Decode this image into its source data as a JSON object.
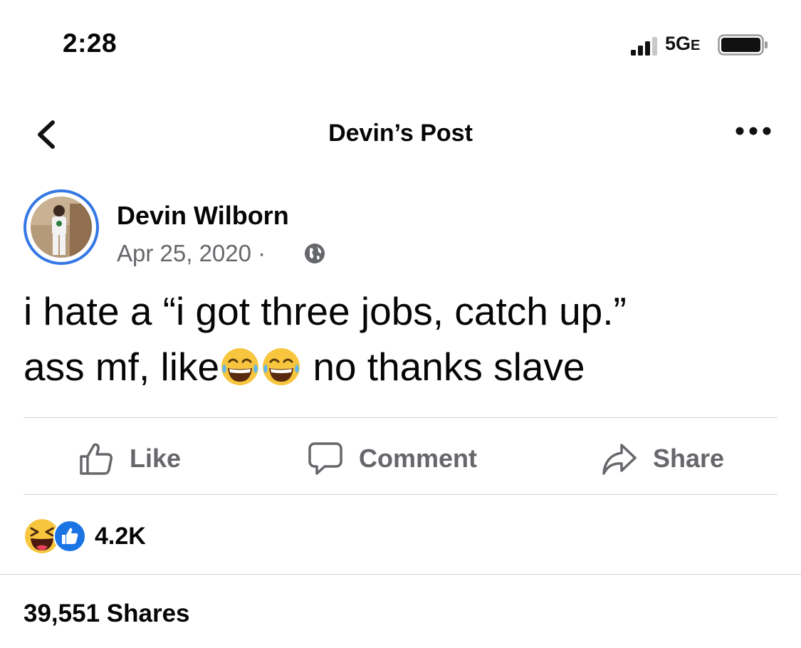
{
  "status_bar": {
    "time": "2:28",
    "network": "5G",
    "network_suffix": "E"
  },
  "header": {
    "title": "Devin’s Post"
  },
  "post": {
    "author": "Devin Wilborn",
    "date": "Apr 25, 2020",
    "date_separator": "·",
    "line1": "i hate a “i got three jobs, catch up.”",
    "line2_start": "ass mf, like",
    "line2_end": "no thanks slave"
  },
  "actions": {
    "like": "Like",
    "comment": "Comment",
    "share": "Share"
  },
  "reactions": {
    "count": "4.2K"
  },
  "shares": {
    "label": "39,551 Shares"
  },
  "colors": {
    "accent": "#3578e5",
    "secondary_text": "#65676b",
    "divider": "#d3d4d7"
  },
  "icons": [
    "signal-icon",
    "battery-icon",
    "back-icon",
    "more-icon",
    "globe-icon",
    "laughing-emoji-icon",
    "like-icon",
    "comment-icon",
    "share-icon",
    "haha-reaction-icon",
    "like-reaction-icon"
  ]
}
